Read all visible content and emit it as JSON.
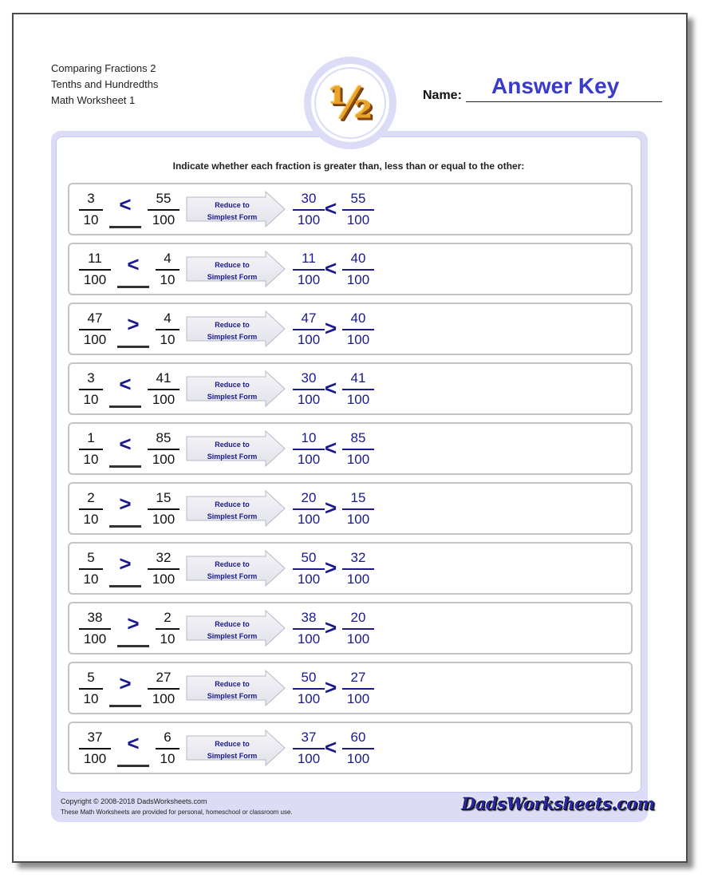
{
  "header": {
    "title_lines": [
      "Comparing Fractions 2",
      "Tenths and Hundredths",
      "Math Worksheet 1"
    ],
    "logo_icon": "one-half-icon",
    "logo_glyph": "½",
    "name_label": "Name:",
    "name_value": "Answer Key"
  },
  "instructions": "Indicate whether each fraction is greater than, less than or equal to the other:",
  "arrow_label_line1": "Reduce to",
  "arrow_label_line2": "Simplest Form",
  "problems": [
    {
      "left": {
        "num": "3",
        "den": "10"
      },
      "answer": "<",
      "right": {
        "num": "55",
        "den": "100"
      },
      "reduced_left": {
        "num": "30",
        "den": "100"
      },
      "reduced_cmp": "<",
      "reduced_right": {
        "num": "55",
        "den": "100"
      }
    },
    {
      "left": {
        "num": "11",
        "den": "100"
      },
      "answer": "<",
      "right": {
        "num": "4",
        "den": "10"
      },
      "reduced_left": {
        "num": "11",
        "den": "100"
      },
      "reduced_cmp": "<",
      "reduced_right": {
        "num": "40",
        "den": "100"
      }
    },
    {
      "left": {
        "num": "47",
        "den": "100"
      },
      "answer": ">",
      "right": {
        "num": "4",
        "den": "10"
      },
      "reduced_left": {
        "num": "47",
        "den": "100"
      },
      "reduced_cmp": ">",
      "reduced_right": {
        "num": "40",
        "den": "100"
      }
    },
    {
      "left": {
        "num": "3",
        "den": "10"
      },
      "answer": "<",
      "right": {
        "num": "41",
        "den": "100"
      },
      "reduced_left": {
        "num": "30",
        "den": "100"
      },
      "reduced_cmp": "<",
      "reduced_right": {
        "num": "41",
        "den": "100"
      }
    },
    {
      "left": {
        "num": "1",
        "den": "10"
      },
      "answer": "<",
      "right": {
        "num": "85",
        "den": "100"
      },
      "reduced_left": {
        "num": "10",
        "den": "100"
      },
      "reduced_cmp": "<",
      "reduced_right": {
        "num": "85",
        "den": "100"
      }
    },
    {
      "left": {
        "num": "2",
        "den": "10"
      },
      "answer": ">",
      "right": {
        "num": "15",
        "den": "100"
      },
      "reduced_left": {
        "num": "20",
        "den": "100"
      },
      "reduced_cmp": ">",
      "reduced_right": {
        "num": "15",
        "den": "100"
      }
    },
    {
      "left": {
        "num": "5",
        "den": "10"
      },
      "answer": ">",
      "right": {
        "num": "32",
        "den": "100"
      },
      "reduced_left": {
        "num": "50",
        "den": "100"
      },
      "reduced_cmp": ">",
      "reduced_right": {
        "num": "32",
        "den": "100"
      }
    },
    {
      "left": {
        "num": "38",
        "den": "100"
      },
      "answer": ">",
      "right": {
        "num": "2",
        "den": "10"
      },
      "reduced_left": {
        "num": "38",
        "den": "100"
      },
      "reduced_cmp": ">",
      "reduced_right": {
        "num": "20",
        "den": "100"
      }
    },
    {
      "left": {
        "num": "5",
        "den": "10"
      },
      "answer": ">",
      "right": {
        "num": "27",
        "den": "100"
      },
      "reduced_left": {
        "num": "50",
        "den": "100"
      },
      "reduced_cmp": ">",
      "reduced_right": {
        "num": "27",
        "den": "100"
      }
    },
    {
      "left": {
        "num": "37",
        "den": "100"
      },
      "answer": "<",
      "right": {
        "num": "6",
        "den": "10"
      },
      "reduced_left": {
        "num": "37",
        "den": "100"
      },
      "reduced_cmp": "<",
      "reduced_right": {
        "num": "60",
        "den": "100"
      }
    }
  ],
  "footer": {
    "copyright": "Copyright © 2008-2018 DadsWorksheets.com",
    "notice": "These Math Worksheets are provided for personal, homeschool or classroom use.",
    "brand": "DadsWorksheets.com"
  },
  "colors": {
    "accent_blue": "#1a1a8c",
    "answer_key": "#3a3acc",
    "panel": "#dcdcf6"
  }
}
